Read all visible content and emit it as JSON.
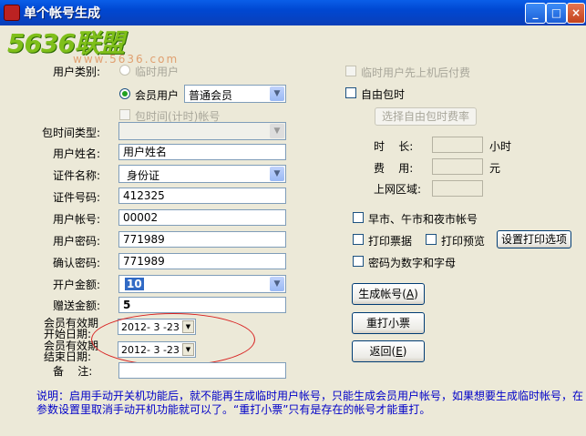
{
  "window": {
    "title": "单个帐号生成",
    "minimize": "_",
    "maximize": "□",
    "close": "×"
  },
  "watermark": {
    "logo": "5636联盟",
    "url": "www.5636.com"
  },
  "form": {
    "user_type_label": "用户类别:",
    "temp_user": "临时用户",
    "member_user": "会员用户",
    "member_level": "普通会员",
    "timed_package": "包时间(计时)帐号",
    "package_type_label": "包时间类型:",
    "user_name_label": "用户姓名:",
    "user_name_value": "用户姓名",
    "id_type_label": "证件名称:",
    "id_type_value": "身份证",
    "id_number_label": "证件号码:",
    "id_number_value": "412325",
    "account_label": "用户帐号:",
    "account_value": "00002",
    "password_label": "用户密码:",
    "password_value": "771989",
    "confirm_label": "确认密码:",
    "confirm_value": "771989",
    "open_amount_label": "开户金额:",
    "open_amount_value": "10",
    "gift_amount_label": "赠送金额:",
    "gift_amount_value": "5",
    "start_date_label": "会员有效期开始日期:",
    "start_date_value": "2012- 3 -23",
    "end_date_label": "会员有效期结束日期:",
    "end_date_value": "2012- 3 -23",
    "remark_label": "备    注:",
    "remark_value": ""
  },
  "right": {
    "temp_prepay": "临时用户先上机后付费",
    "free_package": "自由包时",
    "choose_rate": "选择自由包时费率",
    "time_label": "时    长:",
    "time_unit": "小时",
    "fee_label": "费    用:",
    "fee_unit": "元",
    "zone_label": "上网区域:",
    "morning_acct": "早市、午市和夜市帐号",
    "print_ticket": "打印票据",
    "print_preview": "打印预览",
    "print_options": "设置打印选项",
    "pwd_alnum": "密码为数字和字母",
    "generate_btn": "生成帐号",
    "generate_key": "A",
    "reprint_btn": "重打小票",
    "back_btn": "返回",
    "back_key": "E"
  },
  "note": "说明：启用手动开关机功能后，就不能再生成临时用户帐号，只能生成会员用户帐号，如果想要生成临时帐号，在参数设置里取消手动开机功能就可以了。“重打小票”只有是存在的帐号才能重打。"
}
